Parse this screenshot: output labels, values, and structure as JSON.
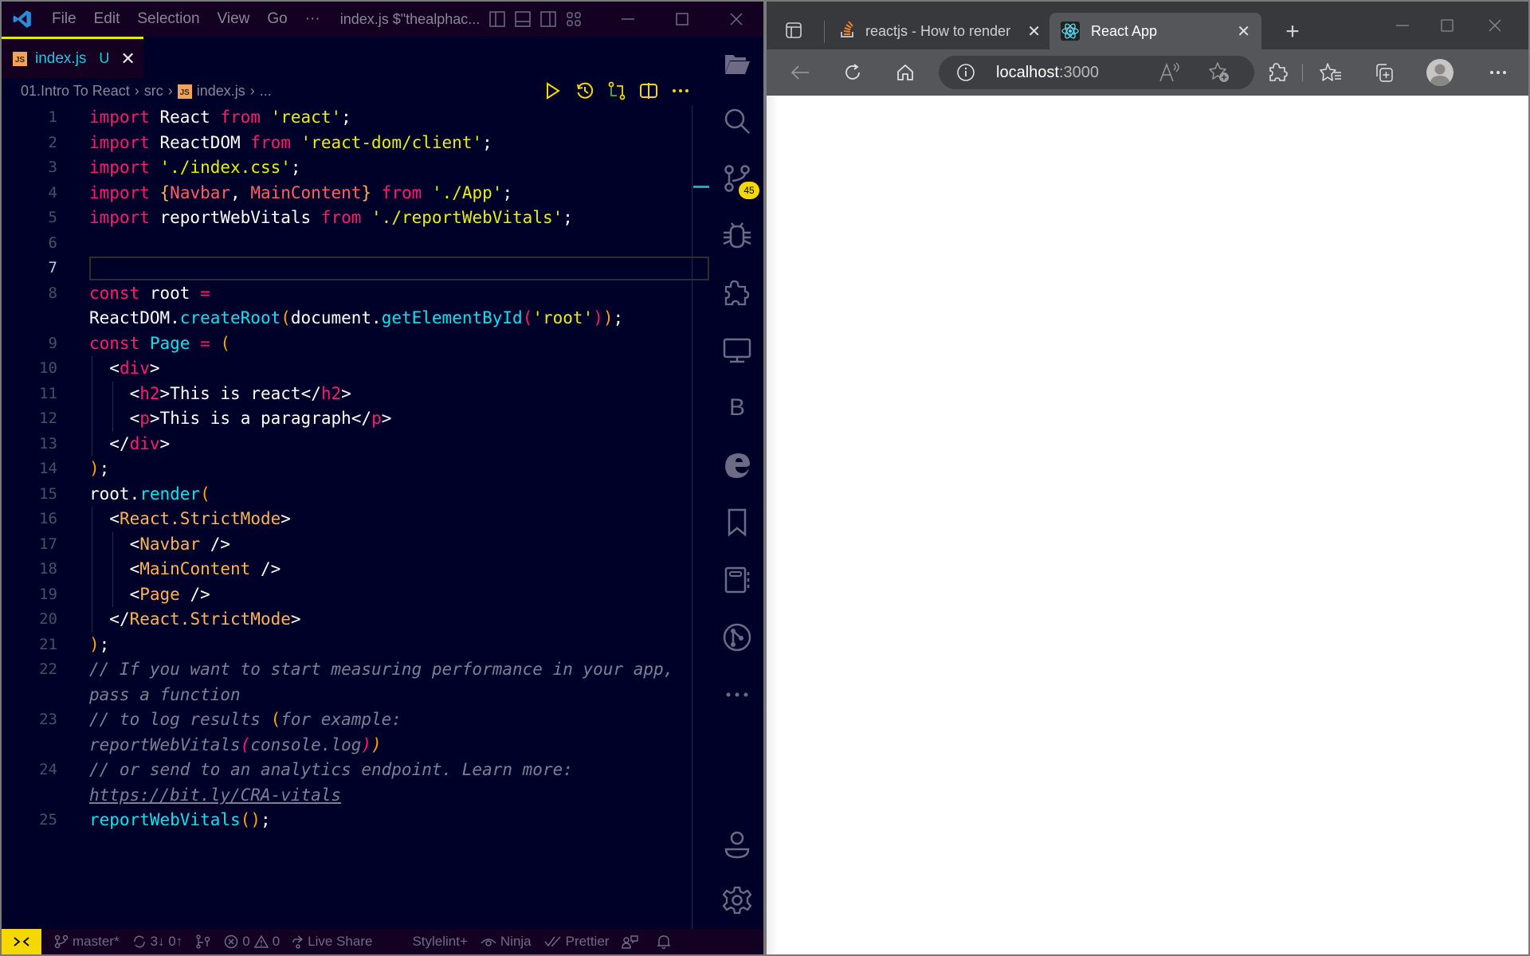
{
  "vscode": {
    "menu": [
      "File",
      "Edit",
      "Selection",
      "View",
      "Go"
    ],
    "menu_more": "···",
    "window_title": "index.js $\"thealphac...",
    "tab": {
      "icon_label": "JS",
      "name": "index.js",
      "status": "U",
      "close": "✕"
    },
    "breadcrumb": {
      "items": [
        "01.Intro To React",
        "src",
        "index.js",
        "..."
      ],
      "separator": "›"
    },
    "accent_color": "#f5d800",
    "line_numbers": [
      "1",
      "2",
      "3",
      "4",
      "5",
      "6",
      "7",
      "8",
      "",
      "9",
      "10",
      "11",
      "12",
      "13",
      "14",
      "15",
      "16",
      "17",
      "18",
      "19",
      "20",
      "21",
      "22",
      "",
      "23",
      "",
      "24",
      "",
      "25"
    ],
    "active_line": "7",
    "code_lines": [
      "import React from 'react';",
      "import ReactDOM from 'react-dom/client';",
      "import './index.css';",
      "import {Navbar, MainContent} from './App';",
      "import reportWebVitals from './reportWebVitals';",
      "",
      "",
      "const root =",
      "ReactDOM.createRoot(document.getElementById('root'));",
      "const Page = (",
      "  <div>",
      "    <h2>This is react</h2>",
      "    <p>This is a paragraph</p>",
      "  </div>",
      ");",
      "root.render(",
      "  <React.StrictMode>",
      "    <Navbar />",
      "    <MainContent />",
      "    <Page />",
      "  </React.StrictMode>",
      ");",
      "// If you want to start measuring performance in your app,",
      "pass a function",
      "// to log results (for example:",
      "reportWebVitals(console.log))",
      "// or send to an analytics endpoint. Learn more:",
      "https://bit.ly/CRA-vitals",
      "reportWebVitals();"
    ],
    "source_control_badge": "45",
    "activity_icons": [
      "explorer-icon",
      "search-icon",
      "source-control-icon",
      "debug-icon",
      "extensions-icon",
      "remote-explorer-icon",
      "bootstrap-icon",
      "edge-devtools-icon",
      "bookmarks-icon",
      "notebook-icon",
      "git-graph-icon",
      "more-icon",
      "accounts-icon",
      "settings-icon"
    ],
    "status": {
      "branch": "master*",
      "sync": "3↓ 0↑",
      "errors": "0",
      "warnings": "0",
      "live_share": "Live Share",
      "stylelint": "Stylelint+",
      "ninja": "Ninja",
      "prettier": "Prettier"
    }
  },
  "browser": {
    "tabs": [
      {
        "title": "reactjs - How to render",
        "favicon": "stackoverflow-icon",
        "active": false
      },
      {
        "title": "React App",
        "favicon": "react-icon",
        "active": true
      }
    ],
    "address": {
      "host": "localhost",
      "port": ":3000"
    },
    "page_content": ""
  }
}
